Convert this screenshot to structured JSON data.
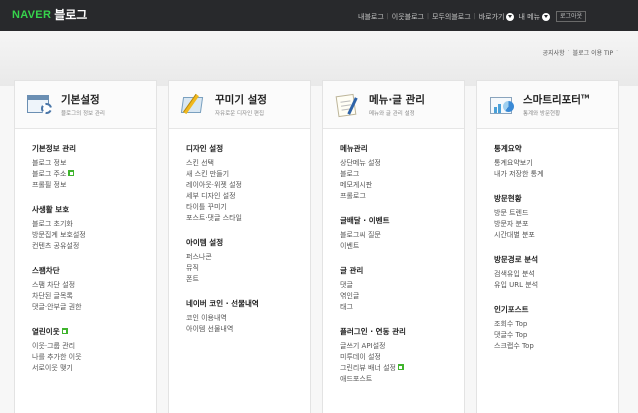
{
  "topbar": {
    "logo_naver": "NAVER",
    "logo_blog": "블로그",
    "nav": [
      "내블로그",
      "이웃블로그",
      "모두의블로그",
      "바로가기",
      "내 메뉴"
    ],
    "logout": "로그아웃"
  },
  "sublinks": [
    "공지사항",
    "블로그 이용 TIP"
  ],
  "columns": [
    {
      "title": "기본설정",
      "subtitle": "블로그의 정보 관리",
      "icon": "settings-window-icon",
      "sections": [
        {
          "title": "기본정보 관리",
          "items": [
            "블로그 정보",
            "블로그 주소",
            "프롤필 정보"
          ],
          "new_on": [
            1
          ]
        },
        {
          "title": "사생활 보호",
          "items": [
            "블로그 초기화",
            "방문집계 보호설정",
            "컨텐츠 공유설정"
          ]
        },
        {
          "title": "스팸차단",
          "items": [
            "스팸 차단 설정",
            "차단된 글목록",
            "댓글·안부글 권한"
          ]
        },
        {
          "title": "열린이웃",
          "items": [
            "이웃·그룹 관리",
            "나를 추가한 이웃",
            "서로이웃 맺기"
          ],
          "title_new": true
        }
      ]
    },
    {
      "title": "꾸미기 설정",
      "subtitle": "자유로운 디자인 편집",
      "icon": "design-pencil-icon",
      "sections": [
        {
          "title": "디자인 설정",
          "items": [
            "스킨 선택",
            "새 스킨 만들기",
            "레이아웃·위젯 설정",
            "세부 디자인 설정",
            "타이틀 꾸미기",
            "포스트·댓글 스타일"
          ]
        },
        {
          "title": "아이템 설정",
          "items": [
            "퍼스나콘",
            "뮤직",
            "폰트"
          ]
        },
        {
          "title": "네이버 코인 · 선물내역",
          "items": [
            "코인 이용내역",
            "아이템 선물내역"
          ]
        }
      ]
    },
    {
      "title": "메뉴·글 관리",
      "subtitle": "메뉴와 글 관리 설정",
      "icon": "document-pen-icon",
      "sections": [
        {
          "title": "메뉴관리",
          "items": [
            "상단메뉴 설정",
            "블로그",
            "메모게시판",
            "프롤로그"
          ]
        },
        {
          "title": "글배달 · 이벤트",
          "items": [
            "블로그씨 질문",
            "이벤트"
          ]
        },
        {
          "title": "글 관리",
          "items": [
            "댓글",
            "엮인글",
            "태그"
          ]
        },
        {
          "title": "플러그인 · 연동 관리",
          "items": [
            "글쓰기 API설정",
            "미투데이 설정",
            "그린리뷰 배너 설정",
            "애드포스트"
          ],
          "new_on": [
            2
          ]
        }
      ]
    },
    {
      "title": "스마트리포터",
      "title_sup": "TM",
      "subtitle": "통계와 방문현황",
      "icon": "stats-chart-icon",
      "sections": [
        {
          "title": "통계요약",
          "items": [
            "통계요약보기",
            "내가 저장한 통계"
          ]
        },
        {
          "title": "방문현황",
          "items": [
            "방문 트렌드",
            "방문자 분포",
            "시간대별 분포"
          ]
        },
        {
          "title": "방문경로 분석",
          "items": [
            "검색유입 분석",
            "유입 URL 분석"
          ]
        },
        {
          "title": "인기포스트",
          "items": [
            "조회수 Top",
            "댓글수 Top",
            "스크랩수 Top"
          ]
        }
      ]
    }
  ],
  "colors": {
    "topbar": "#28292c",
    "naver_green": "#36d34c",
    "new_badge": "#3fb42d"
  }
}
